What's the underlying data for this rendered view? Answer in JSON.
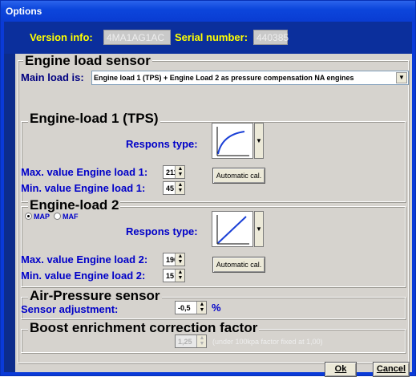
{
  "window": {
    "title": "Options"
  },
  "version_bar": {
    "version_label": "Version info:",
    "version_value": "4MA1AG1AC",
    "serial_label": "Serial number:",
    "serial_value": "440385"
  },
  "engine_load_sensor": {
    "heading": "Engine load sensor",
    "main_load_label": "Main load is:",
    "main_load_value": "Engine load 1 (TPS) + Engine Load 2 as pressure compensation NA engines"
  },
  "engine_load_1": {
    "heading": "Engine-load 1 (TPS)",
    "response_label": "Respons type:",
    "response_curve": "log-curve-icon",
    "max_label": "Max. value Engine load 1:",
    "max_value": "211",
    "min_label": "Min.  value Engine load 1:",
    "min_value": "45",
    "auto_cal": "Automatic cal."
  },
  "engine_load_2": {
    "heading": "Engine-load 2",
    "radio_map": "MAP",
    "radio_maf": "MAF",
    "selected": "MAP",
    "response_label": "Respons type:",
    "response_curve": "linear-curve-icon",
    "max_label": "Max. value Engine load 2:",
    "max_value": "190",
    "min_label": "Min.  value Engine load 2:",
    "min_value": "15",
    "auto_cal": "Automatic cal."
  },
  "air_pressure": {
    "heading": "Air-Pressure sensor",
    "adjust_label": "Sensor adjustment:",
    "adjust_value": "-0,5",
    "unit": "%"
  },
  "boost": {
    "heading": "Boost enrichment correction factor",
    "value": "1,25",
    "hint": "(under 100kpa factor fixed at 1,00)"
  },
  "buttons": {
    "ok": "Ok",
    "cancel": "Cancel"
  },
  "colors": {
    "title_bar": "#0c46dc",
    "version_bar_bg": "#0b2f9c",
    "version_text": "#ffff00",
    "panel_bg": "#d6d3ce",
    "label_blue": "#0000c8"
  }
}
